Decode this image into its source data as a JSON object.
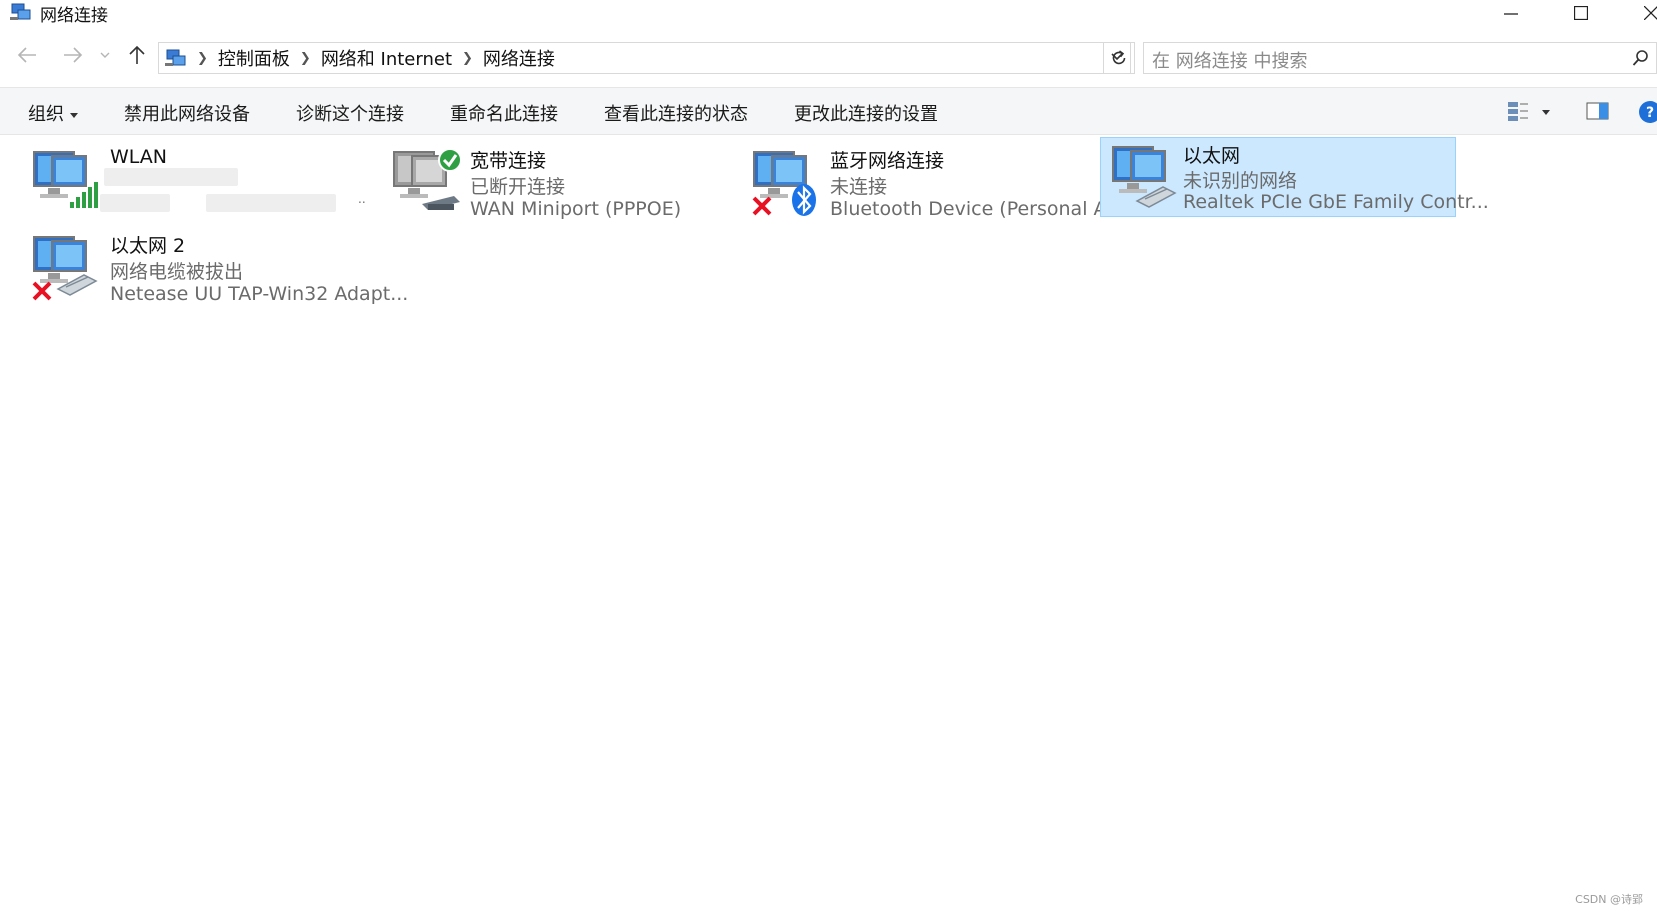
{
  "window": {
    "title": "网络连接"
  },
  "address": {
    "breadcrumbs": [
      "控制面板",
      "网络和 Internet",
      "网络连接"
    ]
  },
  "search": {
    "placeholder": "在 网络连接 中搜索"
  },
  "toolbar": {
    "organize": "组织",
    "disable": "禁用此网络设备",
    "diagnose": "诊断这个连接",
    "rename": "重命名此连接",
    "view_status": "查看此连接的状态",
    "change_settings": "更改此连接的设置"
  },
  "connections": [
    {
      "name": "WLAN",
      "status": "",
      "device": "..",
      "icon": "wifi-adapter-icon",
      "state": "connected"
    },
    {
      "name": "宽带连接",
      "status": "已断开连接",
      "device": "WAN Miniport (PPPOE)",
      "icon": "broadband-icon",
      "state": "disconnected-ok"
    },
    {
      "name": "蓝牙网络连接",
      "status": "未连接",
      "device": "Bluetooth Device (Personal Are...",
      "icon": "bluetooth-network-icon",
      "state": "error"
    },
    {
      "name": "以太网",
      "status": "未识别的网络",
      "device": "Realtek PCIe GbE Family Contr...",
      "icon": "ethernet-icon",
      "state": "selected"
    },
    {
      "name": "以太网 2",
      "status": "网络电缆被拔出",
      "device": "Netease UU TAP-Win32 Adapt...",
      "icon": "ethernet-icon",
      "state": "error"
    }
  ],
  "watermark": "CSDN @诗郢",
  "colors": {
    "selection_bg": "#cce8ff",
    "selection_border": "#99d1ff",
    "error_red": "#e81123",
    "ok_green": "#2ea043",
    "bluetooth_blue": "#1a73e8"
  }
}
